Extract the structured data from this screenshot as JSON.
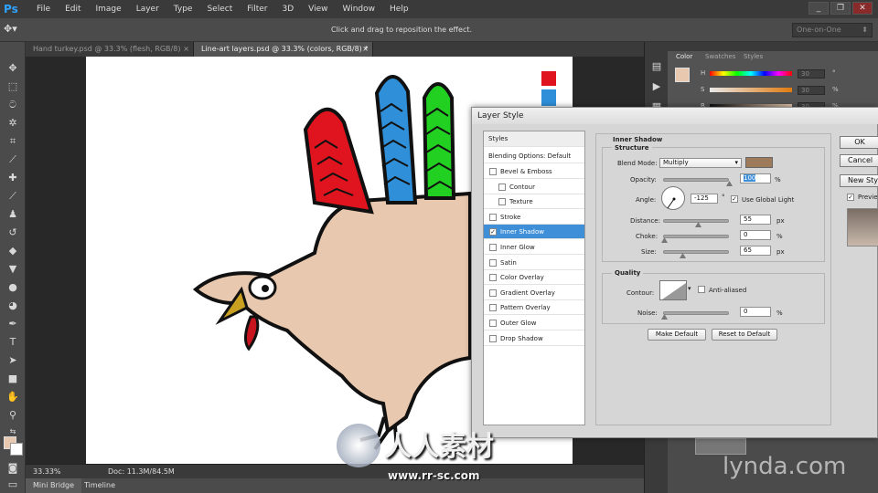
{
  "app": {
    "logo": "Ps",
    "window_controls": [
      "_",
      "❐",
      "✕"
    ]
  },
  "menu": [
    "File",
    "Edit",
    "Image",
    "Layer",
    "Type",
    "Select",
    "Filter",
    "3D",
    "View",
    "Window",
    "Help"
  ],
  "options_bar": {
    "hint": "Click and drag to reposition the effect.",
    "workspace": "One-on-One"
  },
  "tabs": [
    {
      "label": "Hand turkey.psd @ 33.3% (flesh, RGB/8)",
      "active": false
    },
    {
      "label": "Line-art layers.psd @ 33.3% (colors, RGB/8) *",
      "active": true
    }
  ],
  "status": {
    "zoom": "33.33%",
    "doc": "Doc: 11.3M/84.5M"
  },
  "bottom_tabs": [
    "Mini Bridge",
    "Timeline"
  ],
  "color_panel": {
    "tabs": [
      "Color",
      "Swatches",
      "Styles"
    ],
    "rows": [
      {
        "label": "H",
        "value": "30",
        "unit": "°"
      },
      {
        "label": "S",
        "value": "30",
        "unit": "%"
      },
      {
        "label": "B",
        "value": "30",
        "unit": "%"
      }
    ]
  },
  "dialog": {
    "title": "Layer Style",
    "styles_header": "Styles",
    "blending": "Blending Options: Default",
    "items": [
      {
        "label": "Bevel & Emboss",
        "checked": false,
        "indent": false
      },
      {
        "label": "Contour",
        "checked": false,
        "indent": true
      },
      {
        "label": "Texture",
        "checked": false,
        "indent": true
      },
      {
        "label": "Stroke",
        "checked": false,
        "indent": false
      },
      {
        "label": "Inner Shadow",
        "checked": true,
        "indent": false,
        "selected": true
      },
      {
        "label": "Inner Glow",
        "checked": false,
        "indent": false
      },
      {
        "label": "Satin",
        "checked": false,
        "indent": false
      },
      {
        "label": "Color Overlay",
        "checked": false,
        "indent": false
      },
      {
        "label": "Gradient Overlay",
        "checked": false,
        "indent": false
      },
      {
        "label": "Pattern Overlay",
        "checked": false,
        "indent": false
      },
      {
        "label": "Outer Glow",
        "checked": false,
        "indent": false
      },
      {
        "label": "Drop Shadow",
        "checked": false,
        "indent": false
      }
    ],
    "section_title": "Inner Shadow",
    "structure_title": "Structure",
    "blend_mode_label": "Blend Mode:",
    "blend_mode": "Multiply",
    "shadow_color": "#9c7a5a",
    "opacity_label": "Opacity:",
    "opacity": "100",
    "opacity_unit": "%",
    "angle_label": "Angle:",
    "angle": "-125",
    "angle_unit": "°",
    "global_light_label": "Use Global Light",
    "global_light": true,
    "distance_label": "Distance:",
    "distance": "55",
    "distance_unit": "px",
    "choke_label": "Choke:",
    "choke": "0",
    "choke_unit": "%",
    "size_label": "Size:",
    "size": "65",
    "size_unit": "px",
    "quality_title": "Quality",
    "contour_label": "Contour:",
    "antialias_label": "Anti-aliased",
    "noise_label": "Noise:",
    "noise": "0",
    "noise_unit": "%",
    "make_default": "Make Default",
    "reset_default": "Reset to Default",
    "ok": "OK",
    "cancel": "Cancel",
    "new_style": "New Style...",
    "preview": "Preview"
  },
  "branding": {
    "lynda": "lynda.com",
    "watermark_text": "人人素材",
    "watermark_url": "www.rr-sc.com"
  },
  "colors": {
    "finger_red": "#e0141e",
    "finger_blue": "#2f8fd8",
    "finger_green": "#22d022",
    "flesh": "#e8c8ae",
    "beak": "#c9a020",
    "wattle": "#c8141e"
  }
}
